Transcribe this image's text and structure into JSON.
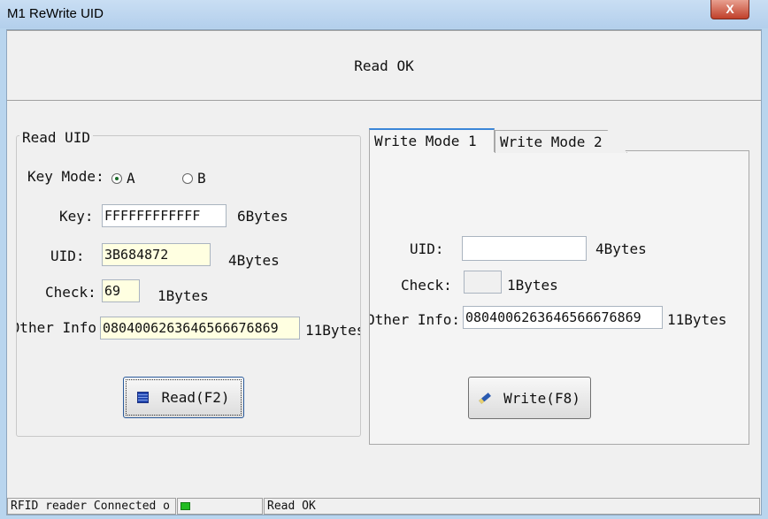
{
  "window": {
    "title": "M1 ReWrite UID",
    "close_label": "X"
  },
  "message": "Read OK",
  "read_uid": {
    "group_label": "Read UID",
    "key_mode_label": "Key Mode:",
    "key_mode_options": [
      "A",
      "B"
    ],
    "key_mode_selected": "A",
    "key_label": "Key:",
    "key_value": "FFFFFFFFFFFF",
    "key_unit": "6Bytes",
    "uid_label": "UID:",
    "uid_value": "3B684872",
    "uid_unit": "4Bytes",
    "check_label": "Check:",
    "check_value": "69",
    "check_unit": "1Bytes",
    "other_label": "Other Info",
    "other_value": "0804006263646566676869",
    "other_unit": "11Bytes",
    "read_button": "Read(F2)"
  },
  "write": {
    "tabs": [
      "Write Mode 1",
      "Write Mode 2"
    ],
    "active_tab": "Write Mode 1",
    "uid_label": "UID:",
    "uid_value": "",
    "uid_unit": "4Bytes",
    "check_label": "Check:",
    "check_value": "",
    "check_unit": "1Bytes",
    "other_label": "Other Info:",
    "other_value": "0804006263646566676869",
    "other_unit": "11Bytes",
    "write_button": "Write(F8)"
  },
  "status": {
    "connection": "RFID reader Connected o",
    "indicator_color": "#22bb22",
    "message": "Read OK"
  }
}
